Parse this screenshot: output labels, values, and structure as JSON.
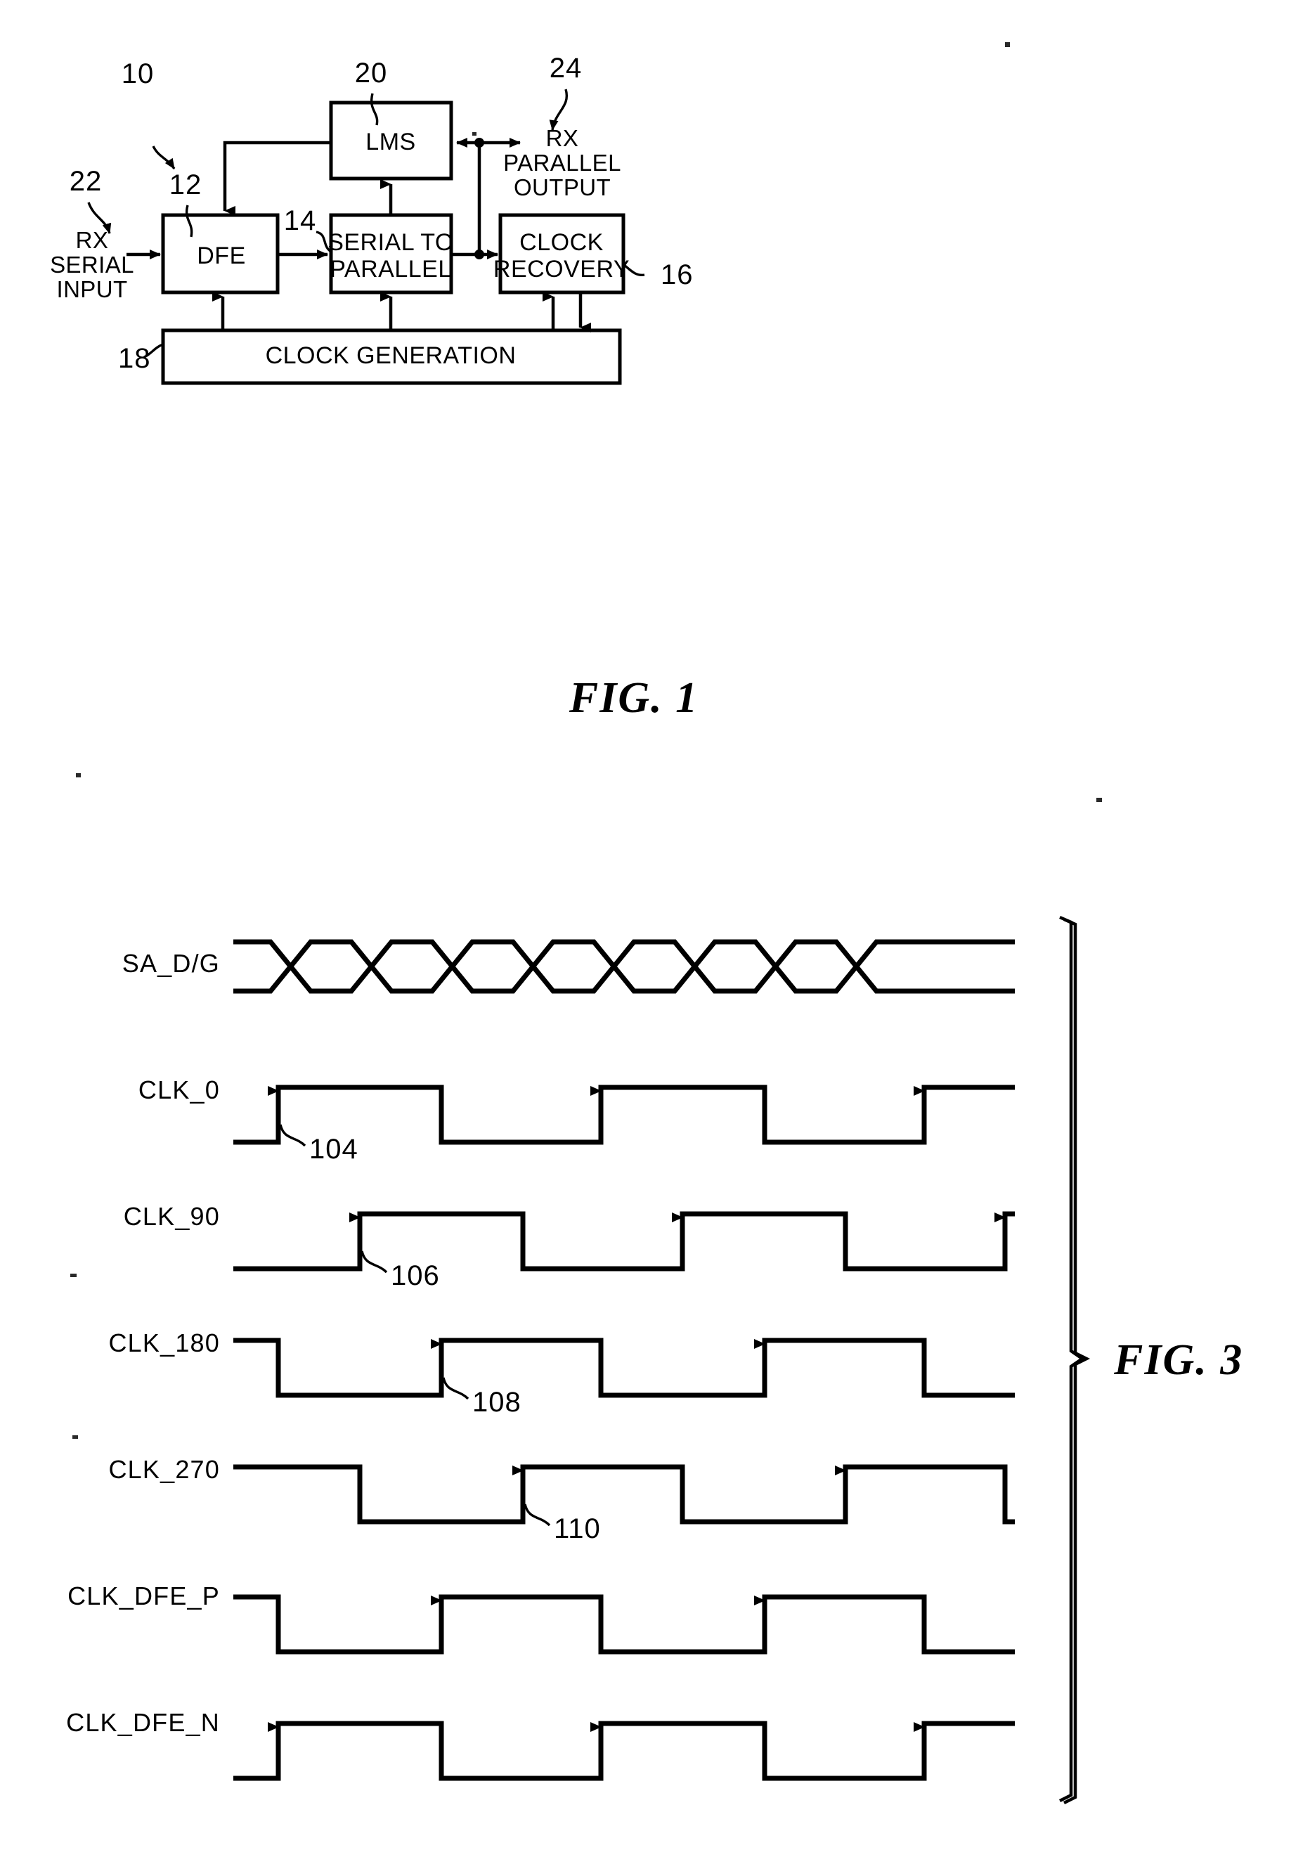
{
  "document": {
    "type": "patent-figure-sheet",
    "figures": [
      "FIG. 1",
      "FIG. 3"
    ]
  },
  "fig1": {
    "caption": "FIG. 1",
    "system_ref": "10",
    "blocks": [
      {
        "id": "dfe",
        "label": "DFE",
        "ref": "12"
      },
      {
        "id": "serial_to_par",
        "label_line1": "SERIAL TO",
        "label_line2": "PARALLEL",
        "ref": "14"
      },
      {
        "id": "clock_recovery",
        "label_line1": "CLOCK",
        "label_line2": "RECOVERY",
        "ref": "16"
      },
      {
        "id": "clock_gen",
        "label": "CLOCK GENERATION",
        "ref": "18"
      },
      {
        "id": "lms",
        "label": "LMS",
        "ref": "20"
      }
    ],
    "ports": [
      {
        "id": "rx_serial_input",
        "ref": "22",
        "line1": "RX",
        "line2": "SERIAL",
        "line3": "INPUT"
      },
      {
        "id": "rx_parallel_output",
        "ref": "24",
        "line1": "RX",
        "line2": "PARALLEL",
        "line3": "OUTPUT"
      }
    ]
  },
  "fig3": {
    "caption": "FIG. 3",
    "signals": [
      {
        "name": "SA_D/G",
        "type": "databus"
      },
      {
        "name": "CLK_0",
        "type": "clock",
        "ref": "104"
      },
      {
        "name": "CLK_90",
        "type": "clock",
        "ref": "106"
      },
      {
        "name": "CLK_180",
        "type": "clock",
        "ref": "108"
      },
      {
        "name": "CLK_270",
        "type": "clock",
        "ref": "110"
      },
      {
        "name": "CLK_DFE_P",
        "type": "clock"
      },
      {
        "name": "CLK_DFE_N",
        "type": "clock"
      }
    ],
    "refs": [
      "104",
      "106",
      "108",
      "110"
    ]
  },
  "chart_data": {
    "type": "line",
    "title": "FIG. 3 — clock phase timing diagram",
    "xlabel": "",
    "ylabel": "",
    "grid": false,
    "legend": "left-labels",
    "xlim": [
      0,
      10
    ],
    "ylim": [
      0,
      1
    ],
    "series": [
      {
        "name": "SA_D/G",
        "kind": "databus",
        "crossings": [
          1.0,
          2.8,
          4.6,
          6.4,
          8.2
        ],
        "eye_half_width": 0.45
      },
      {
        "name": "CLK_0",
        "kind": "clock",
        "phase_deg": 0,
        "rise_times": [
          0.55,
          4.15,
          7.75
        ],
        "fall_times": [
          2.35,
          5.95,
          9.55
        ],
        "start_level": 0,
        "period": 3.6
      },
      {
        "name": "CLK_90",
        "kind": "clock",
        "phase_deg": 90,
        "rise_times": [
          1.45,
          5.05,
          8.65
        ],
        "fall_times": [
          3.25,
          6.85
        ],
        "start_level": 0,
        "period": 3.6
      },
      {
        "name": "CLK_180",
        "kind": "clock",
        "phase_deg": 180,
        "rise_times": [
          2.35,
          5.95,
          9.55
        ],
        "fall_times": [
          0.55,
          4.15,
          7.75
        ],
        "start_level": 1,
        "period": 3.6
      },
      {
        "name": "CLK_270",
        "kind": "clock",
        "phase_deg": 270,
        "rise_times": [
          3.25,
          6.85
        ],
        "fall_times": [
          1.45,
          5.05,
          8.65
        ],
        "start_level": 1,
        "period": 3.6
      },
      {
        "name": "CLK_DFE_P",
        "kind": "clock",
        "rise_times": [
          2.35,
          5.95
        ],
        "fall_times": [
          0.55,
          4.15,
          7.75
        ],
        "start_level": 1,
        "period": 3.6
      },
      {
        "name": "CLK_DFE_N",
        "kind": "clock",
        "rise_times": [
          0.55,
          4.15,
          7.75
        ],
        "fall_times": [
          2.35,
          5.95
        ],
        "start_level": 0,
        "period": 3.6
      }
    ],
    "annotations": [
      {
        "text": "104",
        "points_to": "CLK_0 rising edge 1"
      },
      {
        "text": "106",
        "points_to": "CLK_90 rising edge 1"
      },
      {
        "text": "108",
        "points_to": "CLK_180 rising edge 1"
      },
      {
        "text": "110",
        "points_to": "CLK_270 rising edge 1"
      }
    ]
  }
}
